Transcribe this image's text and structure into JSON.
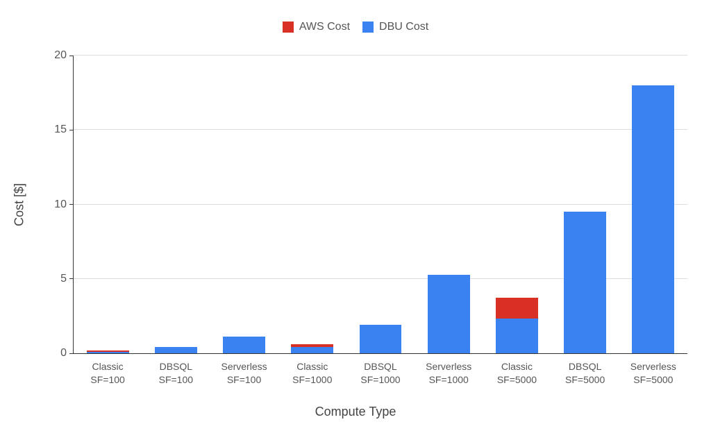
{
  "chart_data": {
    "type": "bar",
    "stacked": true,
    "title": "",
    "xlabel": "Compute Type",
    "ylabel": "Cost [$]",
    "ylim": [
      0,
      20
    ],
    "yticks": [
      0,
      5,
      10,
      15,
      20
    ],
    "categories": [
      "Classic\nSF=100",
      "DBSQL\nSF=100",
      "Serverless\nSF=100",
      "Classic\nSF=1000",
      "DBSQL\nSF=1000",
      "Serverless\nSF=1000",
      "Classic\nSF=5000",
      "DBSQL\nSF=5000",
      "Serverless\nSF=5000"
    ],
    "series": [
      {
        "name": "AWS Cost",
        "color": "#d93025",
        "values": [
          0.1,
          0.0,
          0.0,
          0.2,
          0.0,
          0.0,
          1.4,
          0.0,
          0.0
        ]
      },
      {
        "name": "DBU Cost",
        "color": "#3a81f1",
        "values": [
          0.1,
          0.4,
          1.1,
          0.4,
          1.9,
          5.25,
          2.35,
          9.5,
          18.0
        ]
      }
    ],
    "legend_position": "top",
    "grid": true
  }
}
